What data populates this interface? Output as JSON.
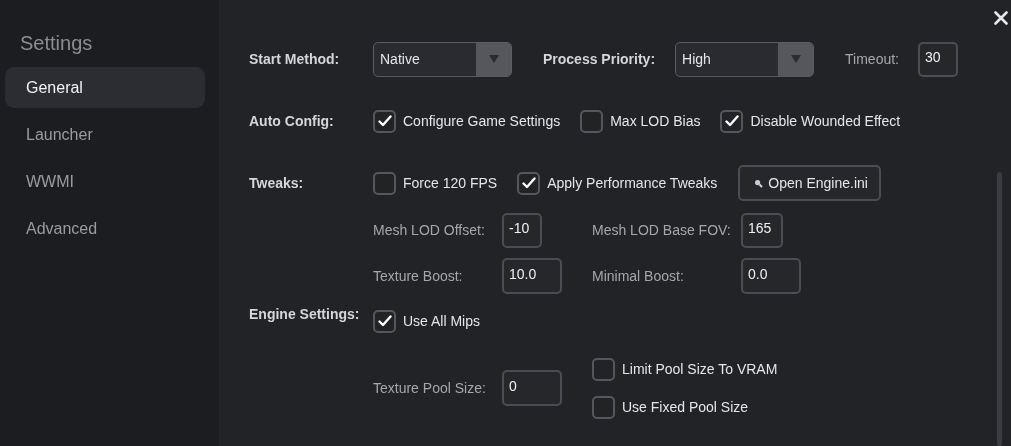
{
  "sidebar": {
    "title": "Settings",
    "items": [
      {
        "label": "General",
        "selected": true
      },
      {
        "label": "Launcher",
        "selected": false
      },
      {
        "label": "WWMI",
        "selected": false
      },
      {
        "label": "Advanced",
        "selected": false
      }
    ]
  },
  "start_method": {
    "label": "Start Method:",
    "value": "Native"
  },
  "process_priority": {
    "label": "Process Priority:",
    "value": "High"
  },
  "timeout": {
    "label": "Timeout:",
    "value": "30"
  },
  "auto_config": {
    "label": "Auto Config:",
    "options": [
      {
        "label": "Configure Game Settings",
        "checked": true
      },
      {
        "label": "Max LOD Bias",
        "checked": false
      },
      {
        "label": "Disable Wounded Effect",
        "checked": true
      }
    ]
  },
  "tweaks": {
    "label": "Tweaks:",
    "options": [
      {
        "label": "Force 120 FPS",
        "checked": false
      },
      {
        "label": "Apply Performance Tweaks",
        "checked": true
      }
    ],
    "button": "Open Engine.ini"
  },
  "engine_settings": {
    "label": "Engine Settings:",
    "fields": [
      {
        "label": "Mesh LOD Offset:",
        "value": "-10"
      },
      {
        "label": "Mesh LOD Base FOV:",
        "value": "165"
      },
      {
        "label": "Texture Boost:",
        "value": "10.0"
      },
      {
        "label": "Minimal Boost:",
        "value": "0.0"
      }
    ],
    "use_all_mips": {
      "label": "Use All Mips",
      "checked": true
    },
    "texture_pool_size": {
      "label": "Texture Pool Size:",
      "value": "0"
    },
    "pool_options": [
      {
        "label": "Limit Pool Size To VRAM",
        "checked": false
      },
      {
        "label": "Use Fixed Pool Size",
        "checked": false
      }
    ]
  }
}
